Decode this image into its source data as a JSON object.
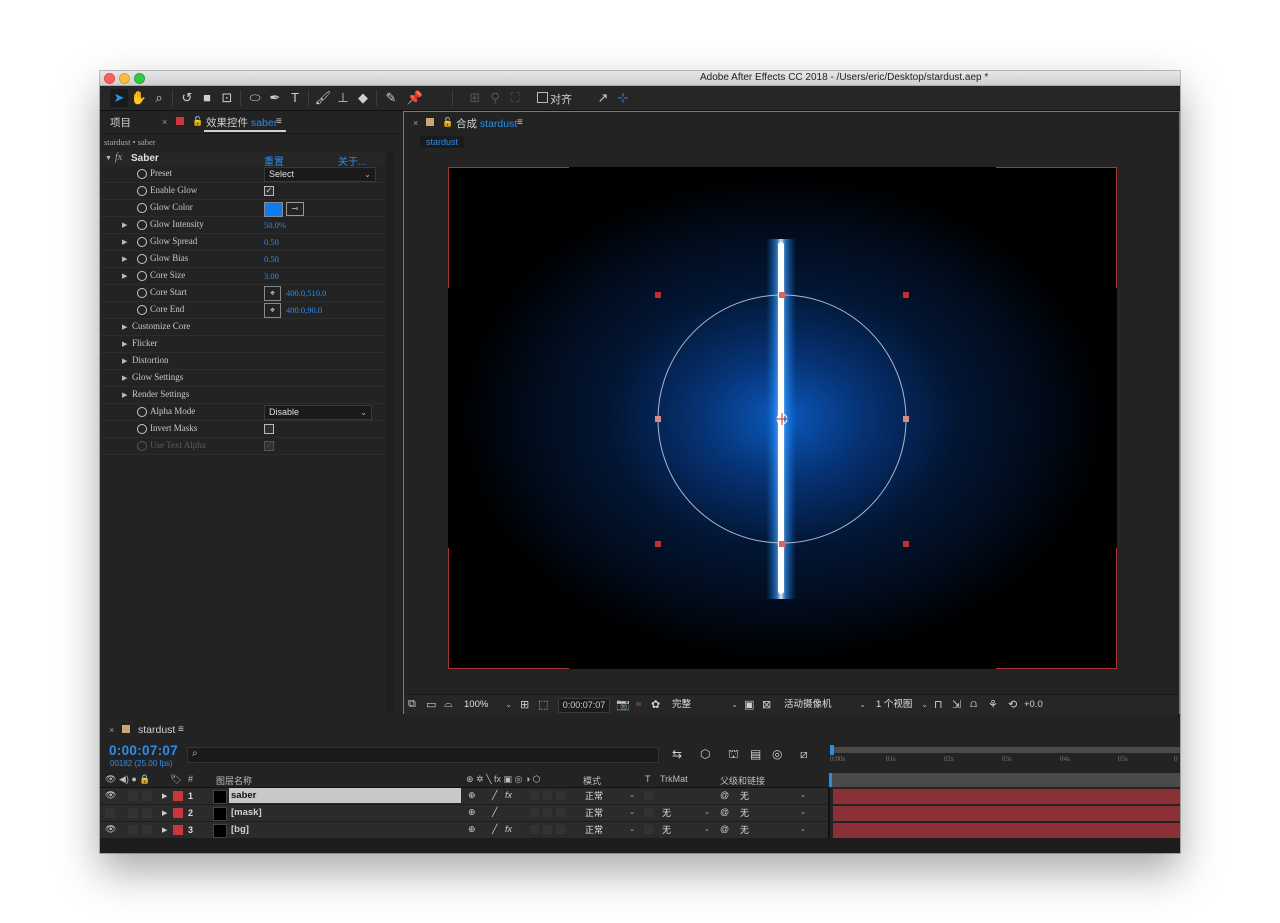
{
  "window": {
    "title": "Adobe After Effects CC 2018 - /Users/eric/Desktop/stardust.aep *"
  },
  "toolbar": {
    "align_label": "对齐"
  },
  "left_panel": {
    "tab_project": "项目",
    "tab_effects_prefix": "效果控件",
    "tab_effects_layer": "saber",
    "breadcrumb": "stardust • saber",
    "effect_name": "Saber",
    "reset_label": "重置",
    "about_label": "关于...",
    "properties": [
      {
        "label": "Preset",
        "value": "Select"
      },
      {
        "label": "Enable Glow",
        "checked": true
      },
      {
        "label": "Glow Color",
        "color": "#0a7cf5"
      },
      {
        "label": "Glow Intensity",
        "value": "50.0%"
      },
      {
        "label": "Glow Spread",
        "value": "0.50"
      },
      {
        "label": "Glow Bias",
        "value": "0.50"
      },
      {
        "label": "Core Size",
        "value": "3.00"
      },
      {
        "label": "Core Start",
        "value": "400.0,510.0"
      },
      {
        "label": "Core End",
        "value": "400.0,90.0"
      },
      {
        "label": "Customize Core"
      },
      {
        "label": "Flicker"
      },
      {
        "label": "Distortion"
      },
      {
        "label": "Glow Settings"
      },
      {
        "label": "Render Settings"
      },
      {
        "label": "Alpha Mode",
        "value": "Disable"
      },
      {
        "label": "Invert Masks",
        "checked": false
      },
      {
        "label": "Use Text Alpha",
        "checked": true,
        "disabled": true
      }
    ]
  },
  "comp_panel": {
    "tab_prefix": "合成",
    "tab_name": "stardust",
    "subtab": "stardust",
    "zoom": "100%",
    "timecode": "0:00:07:07",
    "resolution": "完整",
    "camera": "活动摄像机",
    "views": "1 个视图",
    "exposure": "+0.0"
  },
  "timeline": {
    "tab": "stardust",
    "timecode": "0:00:07:07",
    "frame_info": "00182 (25.00 fps)",
    "search_placeholder": "",
    "columns": {
      "hash": "#",
      "layer_name": "图层名称",
      "mode": "模式",
      "t": "T",
      "trkmat": "TrkMat",
      "parent": "父级和链接"
    },
    "ruler_ticks": [
      "0:00s",
      "01s",
      "02s",
      "03s",
      "04s",
      "05s",
      "0"
    ],
    "layers": [
      {
        "num": "1",
        "name": "saber",
        "mode": "正常",
        "trkmat": "",
        "parent": "无",
        "fx": true,
        "selected": true
      },
      {
        "num": "2",
        "name": "[mask]",
        "mode": "正常",
        "trkmat": "无",
        "parent": "无",
        "fx": false,
        "selected": false
      },
      {
        "num": "3",
        "name": "[bg]",
        "mode": "正常",
        "trkmat": "无",
        "parent": "无",
        "fx": true,
        "selected": false
      }
    ]
  },
  "colors": {
    "accent": "#2d8ceb",
    "label_red": "#d0363d",
    "glow_color": "#0a7cf5",
    "track_red": "#8c3038"
  }
}
